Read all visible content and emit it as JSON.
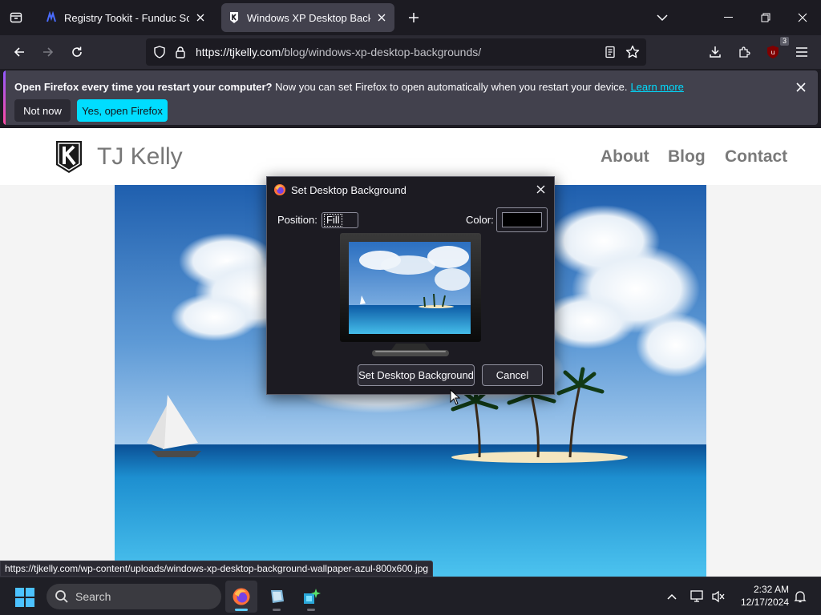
{
  "tabs": [
    {
      "title": "Registry Tookit - Funduc Software",
      "active": false
    },
    {
      "title": "Windows XP Desktop Backgrounds",
      "active": true
    }
  ],
  "navbar": {
    "url_host": "https://tjkelly.com",
    "url_path": "/blog/windows-xp-desktop-backgrounds/",
    "extension_badge": "3"
  },
  "notification": {
    "bold_text": "Open Firefox every time you restart your computer?",
    "text": "Now you can set Firefox to open automatically when you restart your device.",
    "link": "Learn more",
    "not_now": "Not now",
    "yes": "Yes, open Firefox"
  },
  "site": {
    "name": "TJ Kelly",
    "nav": [
      "About",
      "Blog",
      "Contact"
    ]
  },
  "dialog": {
    "title": "Set Desktop Background",
    "position_label": "Position:",
    "position_value": "Fill",
    "color_label": "Color:",
    "color_value": "#000000",
    "set_button": "Set Desktop Background",
    "cancel_button": "Cancel"
  },
  "status_url": "https://tjkelly.com/wp-content/uploads/windows-xp-desktop-background-wallpaper-azul-800x600.jpg",
  "taskbar": {
    "search_placeholder": "Search",
    "time": "2:32 AM",
    "date": "12/17/2024"
  },
  "colors": {
    "accent": "#00ddff",
    "chrome_dark": "#1c1b22",
    "chrome_mid": "#2b2a33"
  }
}
